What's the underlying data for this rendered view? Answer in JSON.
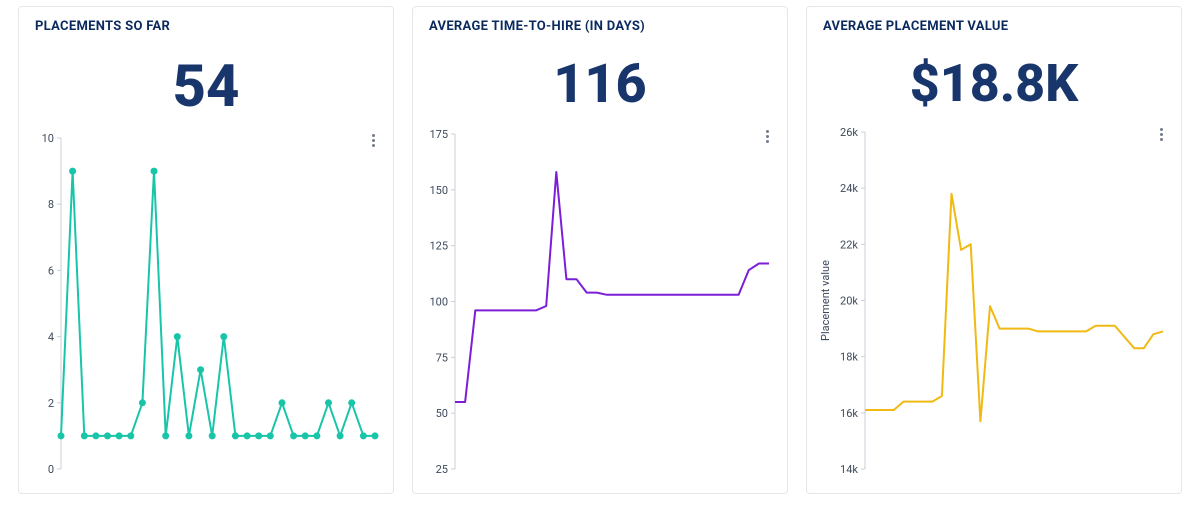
{
  "cards": [
    {
      "title": "PLACEMENTS SO FAR",
      "value_display": "54",
      "color": "#19c5a8",
      "y_ticks": [
        "0",
        "2",
        "4",
        "6",
        "8",
        "10"
      ],
      "y_axis_label": "",
      "name": "placements-card"
    },
    {
      "title": "AVERAGE TIME-TO-HIRE (IN DAYS)",
      "value_display": "116",
      "color": "#7b1fd6",
      "y_ticks": [
        "25",
        "50",
        "75",
        "100",
        "125",
        "150",
        "175"
      ],
      "y_axis_label": "",
      "name": "time-to-hire-card"
    },
    {
      "title": "AVERAGE PLACEMENT VALUE",
      "value_display": "$18.8K",
      "color": "#f0b913",
      "y_ticks": [
        "14k",
        "16k",
        "18k",
        "20k",
        "22k",
        "24k",
        "26k"
      ],
      "y_axis_label": "Placement value",
      "name": "placement-value-card"
    }
  ],
  "chart_data": [
    {
      "type": "line",
      "title": "PLACEMENTS SO FAR",
      "ylabel": "",
      "ylim": [
        0,
        10
      ],
      "markers": true,
      "x": [
        0,
        1,
        2,
        3,
        4,
        5,
        6,
        7,
        8,
        9,
        10,
        11,
        12,
        13,
        14,
        15,
        16,
        17,
        18,
        19,
        20,
        21,
        22,
        23,
        24,
        25,
        26,
        27
      ],
      "values": [
        1,
        9,
        1,
        1,
        1,
        1,
        1,
        2,
        9,
        1,
        4,
        1,
        3,
        1,
        4,
        1,
        1,
        1,
        1,
        2,
        1,
        1,
        1,
        2,
        1,
        2,
        1,
        1
      ]
    },
    {
      "type": "line",
      "title": "AVERAGE TIME-TO-HIRE (IN DAYS)",
      "ylabel": "",
      "ylim": [
        25,
        175
      ],
      "markers": false,
      "x": [
        0,
        1,
        2,
        3,
        4,
        5,
        6,
        7,
        8,
        9,
        10,
        11,
        12,
        13,
        14,
        15,
        16,
        17,
        18,
        19,
        20,
        21,
        22,
        23,
        24,
        25,
        26,
        27,
        28,
        29,
        30,
        31
      ],
      "values": [
        55,
        55,
        96,
        96,
        96,
        96,
        96,
        96,
        96,
        98,
        158,
        110,
        110,
        104,
        104,
        103,
        103,
        103,
        103,
        103,
        103,
        103,
        103,
        103,
        103,
        103,
        103,
        103,
        103,
        114,
        117,
        117
      ]
    },
    {
      "type": "line",
      "title": "AVERAGE PLACEMENT VALUE",
      "ylabel": "Placement value",
      "ylim": [
        14000,
        26000
      ],
      "markers": false,
      "x": [
        0,
        1,
        2,
        3,
        4,
        5,
        6,
        7,
        8,
        9,
        10,
        11,
        12,
        13,
        14,
        15,
        16,
        17,
        18,
        19,
        20,
        21,
        22,
        23,
        24,
        25,
        26,
        27,
        28,
        29,
        30,
        31
      ],
      "values": [
        16100,
        16100,
        16100,
        16100,
        16400,
        16400,
        16400,
        16400,
        16600,
        23800,
        21800,
        22000,
        15700,
        19800,
        19000,
        19000,
        19000,
        19000,
        18900,
        18900,
        18900,
        18900,
        18900,
        18900,
        19100,
        19100,
        19100,
        18700,
        18300,
        18300,
        18800,
        18900
      ]
    }
  ]
}
